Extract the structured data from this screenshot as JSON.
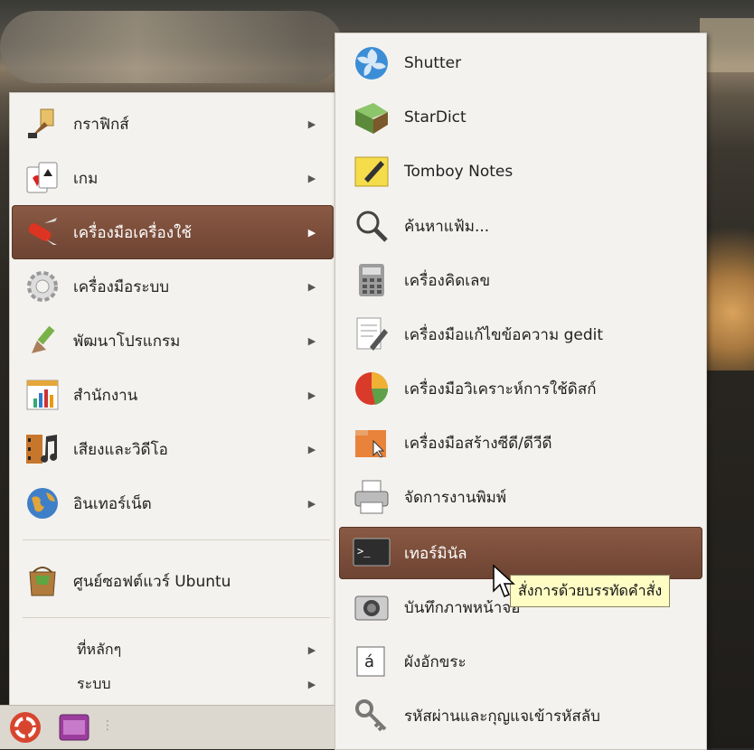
{
  "menu": {
    "items": [
      {
        "label": "กราฟิกส์",
        "icon": "graphics-icon"
      },
      {
        "label": "เกม",
        "icon": "games-icon"
      },
      {
        "label": "เครื่องมือเครื่องใช้",
        "icon": "accessories-icon"
      },
      {
        "label": "เครื่องมือระบบ",
        "icon": "system-tools-icon"
      },
      {
        "label": "พัฒนาโปรแกรม",
        "icon": "programming-icon"
      },
      {
        "label": "สำนักงาน",
        "icon": "office-icon"
      },
      {
        "label": "เสียงและวิดีโอ",
        "icon": "sound-video-icon"
      },
      {
        "label": "อินเทอร์เน็ต",
        "icon": "internet-icon"
      }
    ],
    "software_center": "ศูนย์ซอฟต์แวร์ Ubuntu",
    "places": "ที่หลักๆ",
    "system": "ระบบ"
  },
  "submenu": {
    "items": [
      {
        "label": "Shutter",
        "icon": "shutter-icon"
      },
      {
        "label": "StarDict",
        "icon": "stardict-icon"
      },
      {
        "label": "Tomboy Notes",
        "icon": "tomboy-icon"
      },
      {
        "label": "ค้นหาแฟ้ม...",
        "icon": "search-icon"
      },
      {
        "label": "เครื่องคิดเลข",
        "icon": "calculator-icon"
      },
      {
        "label": "เครื่องมือแก้ไขข้อความ gedit",
        "icon": "text-editor-icon"
      },
      {
        "label": "เครื่องมือวิเคราะห์การใช้ดิสก์",
        "icon": "disk-usage-icon"
      },
      {
        "label": "เครื่องมือสร้างซีดี/ดีวีดี",
        "icon": "cd-burner-icon"
      },
      {
        "label": "จัดการงานพิมพ์",
        "icon": "printer-icon"
      },
      {
        "label": "เทอร์มินัล",
        "icon": "terminal-icon"
      },
      {
        "label": "บันทึกภาพหน้าจอ",
        "icon": "camera-icon"
      },
      {
        "label": "ผังอักขระ",
        "icon": "character-map-icon"
      },
      {
        "label": "รหัสผ่านและกุญแจเข้ารหัสลับ",
        "icon": "keys-icon"
      }
    ]
  },
  "tooltip": "สั่งการด้วยบรรทัดคำสั่ง",
  "arrow": "▶",
  "colors": {
    "selected": "#7a4c3a",
    "menu_bg": "#f4f2ee",
    "tooltip_bg": "#fffdc4"
  }
}
